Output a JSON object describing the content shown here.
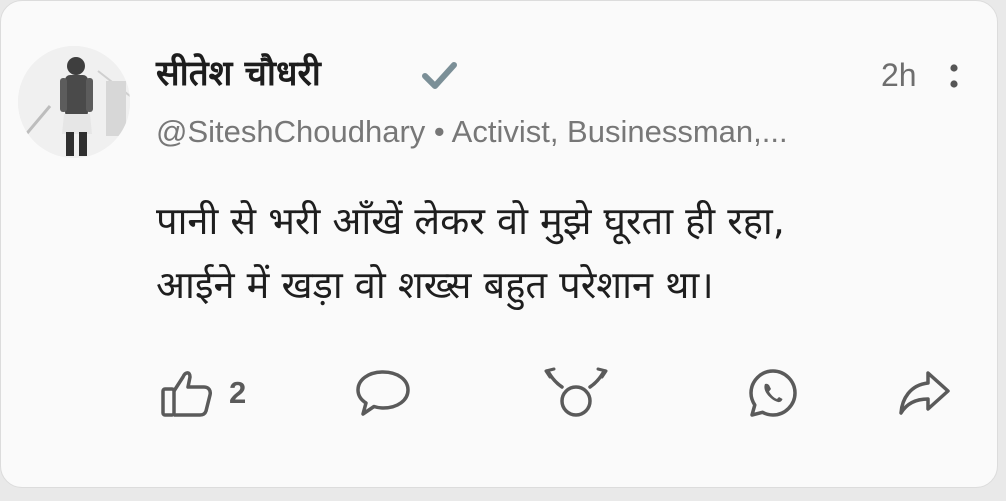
{
  "post": {
    "author_name": "सीतेश चौधरी",
    "verified_icon": "check-icon",
    "time": "2h",
    "handle_line": "@SiteshChoudhary • Activist, Businessman,...",
    "text_line1": "पानी से भरी आँखें लेकर वो मुझे घूरता ही रहा,",
    "text_line2": "आईने में खड़ा वो शख्स बहुत परेशान था।"
  },
  "actions": {
    "like_count": "2",
    "like_icon": "thumbs-up-icon",
    "comment_icon": "comment-icon",
    "bhau_icon": "bhau-icon",
    "whatsapp_icon": "whatsapp-icon",
    "share_icon": "share-icon"
  },
  "colors": {
    "card_background": "#fafafa",
    "verified": "#7b8f97",
    "icon_gray": "#5a5a5a"
  }
}
